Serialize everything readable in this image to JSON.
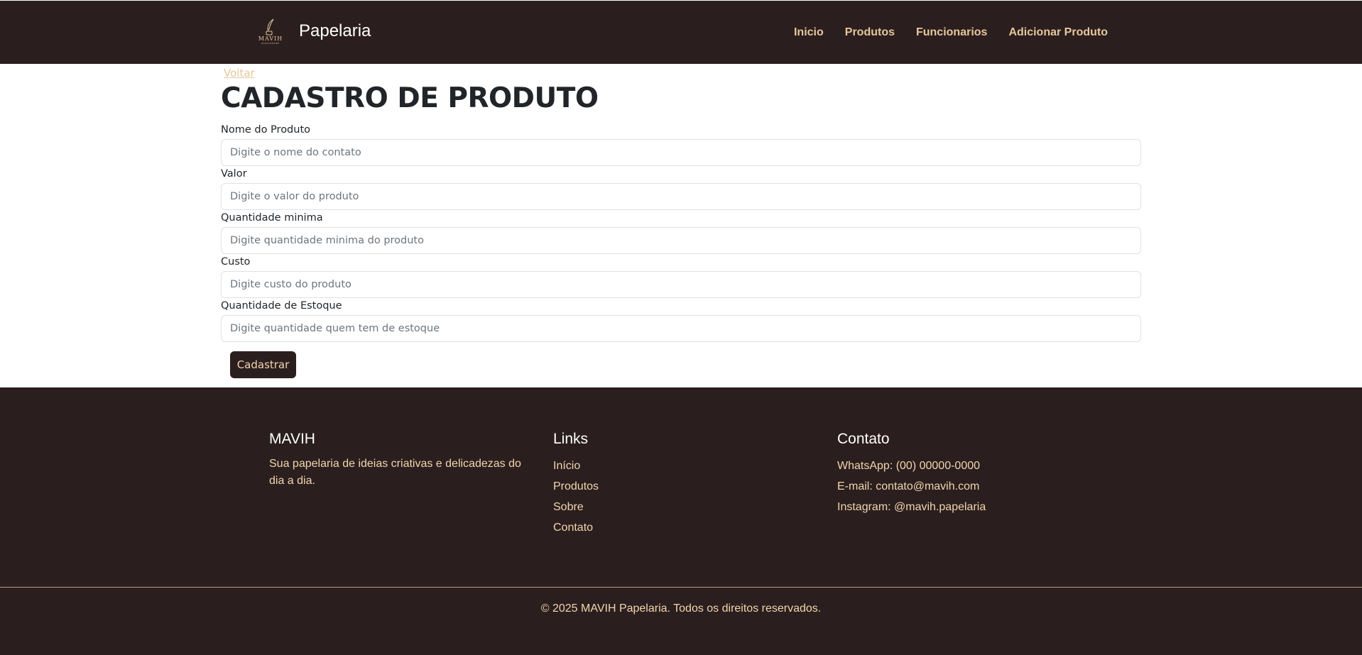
{
  "header": {
    "logo_text": "MAVIH",
    "logo_subtext": "STATIONERY",
    "brand_name": "Papelaria",
    "nav": [
      {
        "label": "Inicio"
      },
      {
        "label": "Produtos"
      },
      {
        "label": "Funcionarios"
      },
      {
        "label": "Adicionar Produto"
      }
    ]
  },
  "main": {
    "back_link": "Voltar",
    "title": "CADASTRO DE PRODUTO",
    "fields": [
      {
        "label": "Nome do Produto",
        "placeholder": "Digite o nome do contato",
        "value": ""
      },
      {
        "label": "Valor",
        "placeholder": "Digite o valor do produto",
        "value": ""
      },
      {
        "label": "Quantidade minima",
        "placeholder": "Digite quantidade minima do produto",
        "value": ""
      },
      {
        "label": "Custo",
        "placeholder": "Digite custo do produto",
        "value": ""
      },
      {
        "label": "Quantidade de Estoque",
        "placeholder": "Digite quantidade quem tem de estoque",
        "value": ""
      }
    ],
    "submit_label": "Cadastrar"
  },
  "footer": {
    "about": {
      "title": "MAVIH",
      "text": "Sua papelaria de ideias criativas e delicadezas do dia a dia."
    },
    "links": {
      "title": "Links",
      "items": [
        "Início",
        "Produtos",
        "Sobre",
        "Contato"
      ]
    },
    "contact": {
      "title": "Contato",
      "items": [
        "WhatsApp: (00) 00000-0000",
        "E-mail: contato@mavih.com",
        "Instagram: @mavih.papelaria"
      ]
    },
    "copyright": "© 2025 MAVIH Papelaria. Todos os direitos reservados."
  },
  "colors": {
    "primary_dark": "#2b1e1e",
    "accent_gold": "#e6c79c",
    "footer_text": "#f0d6ae"
  }
}
